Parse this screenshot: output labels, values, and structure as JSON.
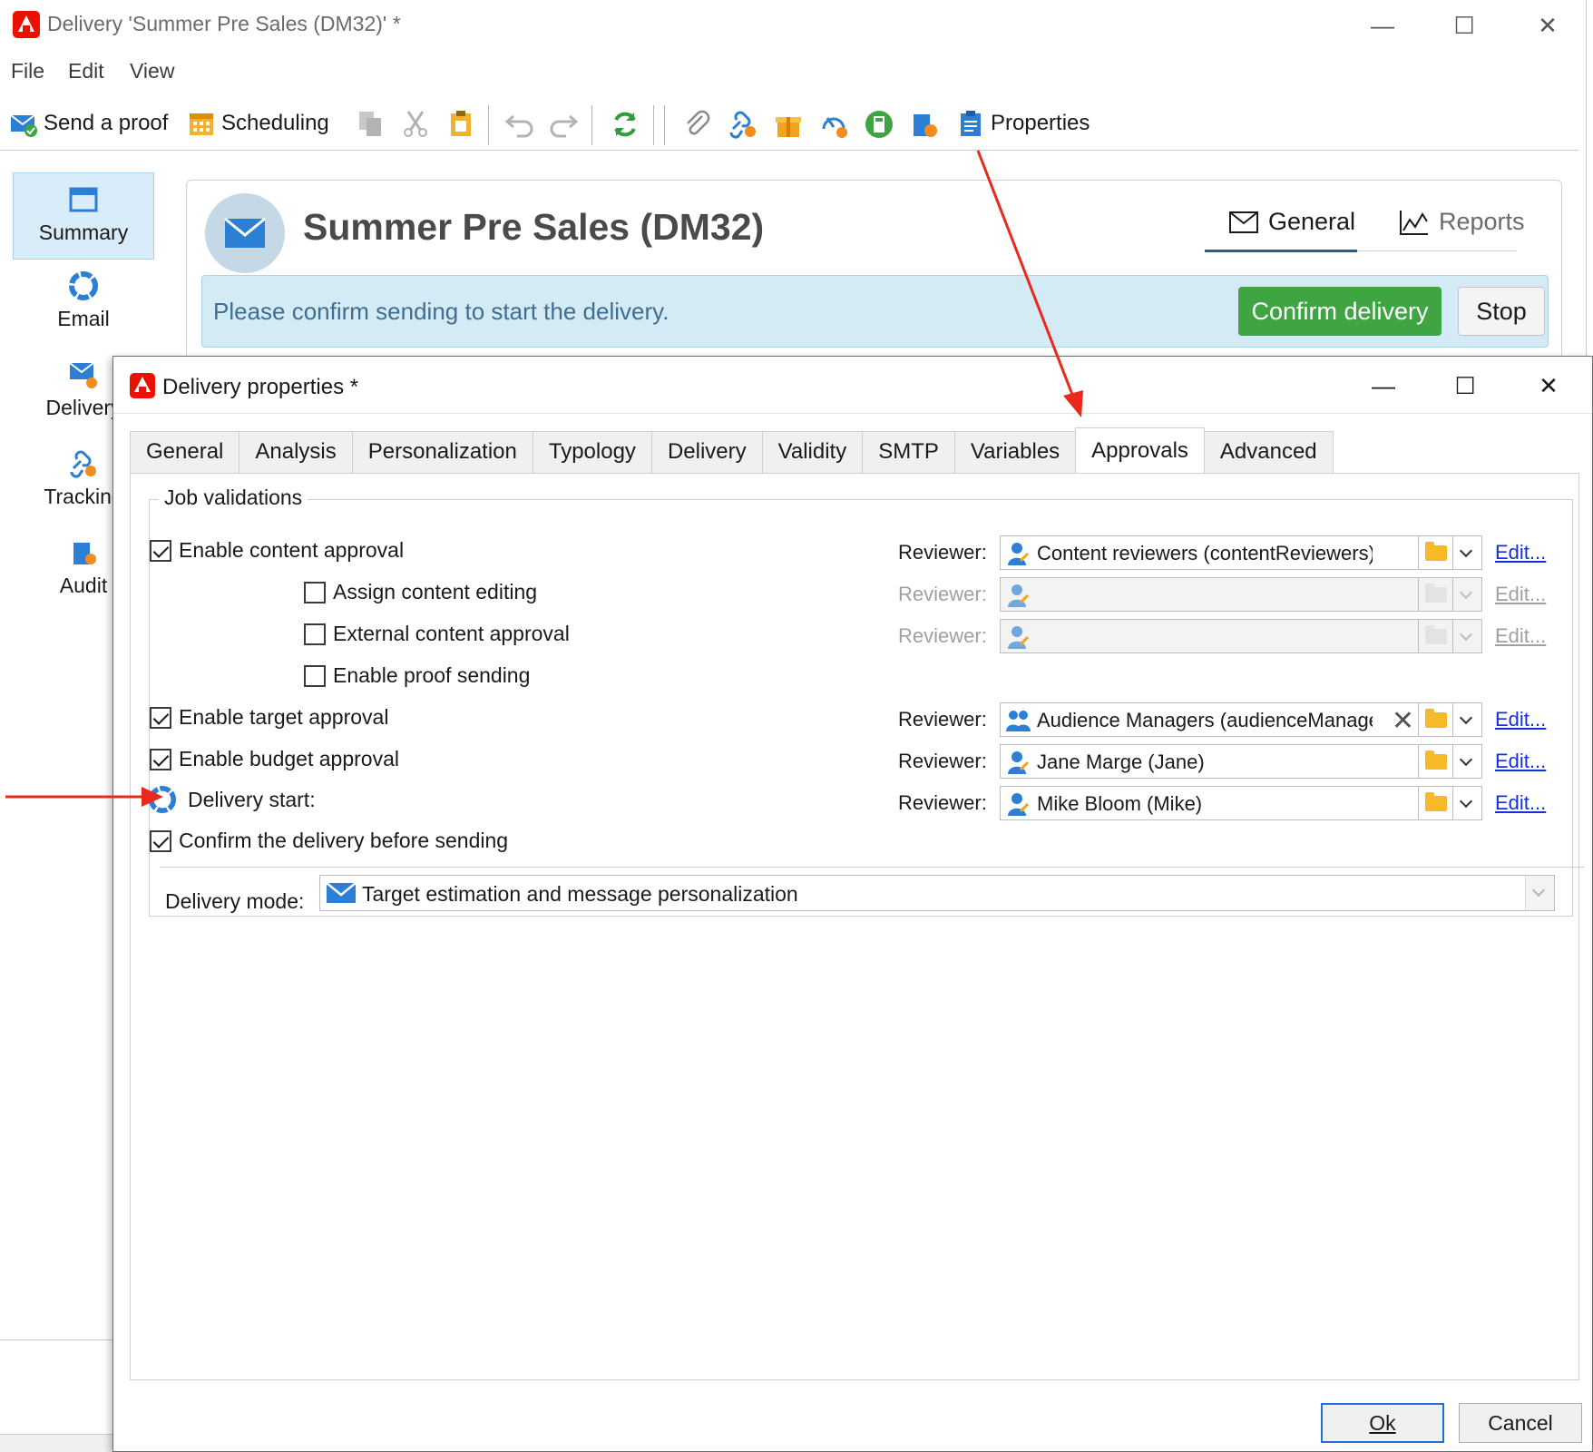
{
  "window": {
    "title": "Delivery 'Summer Pre Sales (DM32)' *",
    "minimize": "—",
    "maximize": "☐",
    "close": "✕"
  },
  "menu": [
    "File",
    "Edit",
    "View"
  ],
  "toolbar": {
    "send_proof": "Send a proof",
    "scheduling": "Scheduling",
    "properties": "Properties"
  },
  "nav": [
    {
      "label": "Summary",
      "icon": "summary-icon",
      "selected": true
    },
    {
      "label": "Email",
      "icon": "email-icon"
    },
    {
      "label": "Delivery",
      "icon": "delivery-icon"
    },
    {
      "label": "Tracking",
      "icon": "tracking-icon"
    },
    {
      "label": "Audit",
      "icon": "audit-icon"
    }
  ],
  "summary": {
    "title": "Summer Pre Sales (DM32)",
    "tab_general": "General",
    "tab_reports": "Reports",
    "alert_text": "Please confirm sending to start the delivery.",
    "confirm_button": "Confirm delivery",
    "stop_button": "Stop"
  },
  "dialog": {
    "title": "Delivery properties *",
    "tabs": [
      "General",
      "Analysis",
      "Personalization",
      "Typology",
      "Delivery",
      "Validity",
      "SMTP",
      "Variables",
      "Approvals",
      "Advanced"
    ],
    "active_tab": "Approvals",
    "group_title": "Job validations",
    "rows": {
      "content_approval": "Enable content approval",
      "assign_editing": "Assign content editing",
      "external_approval": "External content approval",
      "proof_sending": "Enable proof sending",
      "target_approval": "Enable target approval",
      "budget_approval": "Enable budget approval",
      "delivery_start": "Delivery start:",
      "confirm_before": "Confirm the delivery before sending"
    },
    "reviewer_label": "Reviewer:",
    "edit_label": "Edit...",
    "reviewers": {
      "content": "Content reviewers (contentReviewers)",
      "target": "Audience Managers (audienceManagers)",
      "budget": "Jane Marge (Jane)",
      "delivery_start": "Mike Bloom (Mike)"
    },
    "delivery_mode_label": "Delivery mode:",
    "delivery_mode_value": "Target estimation and message personalization",
    "ok": "Ok",
    "cancel": "Cancel"
  },
  "colors": {
    "accent_green": "#3fa542",
    "alert_bg": "#d4ebf5",
    "link_blue": "#1430d6",
    "annotation_red": "#e8291c"
  }
}
